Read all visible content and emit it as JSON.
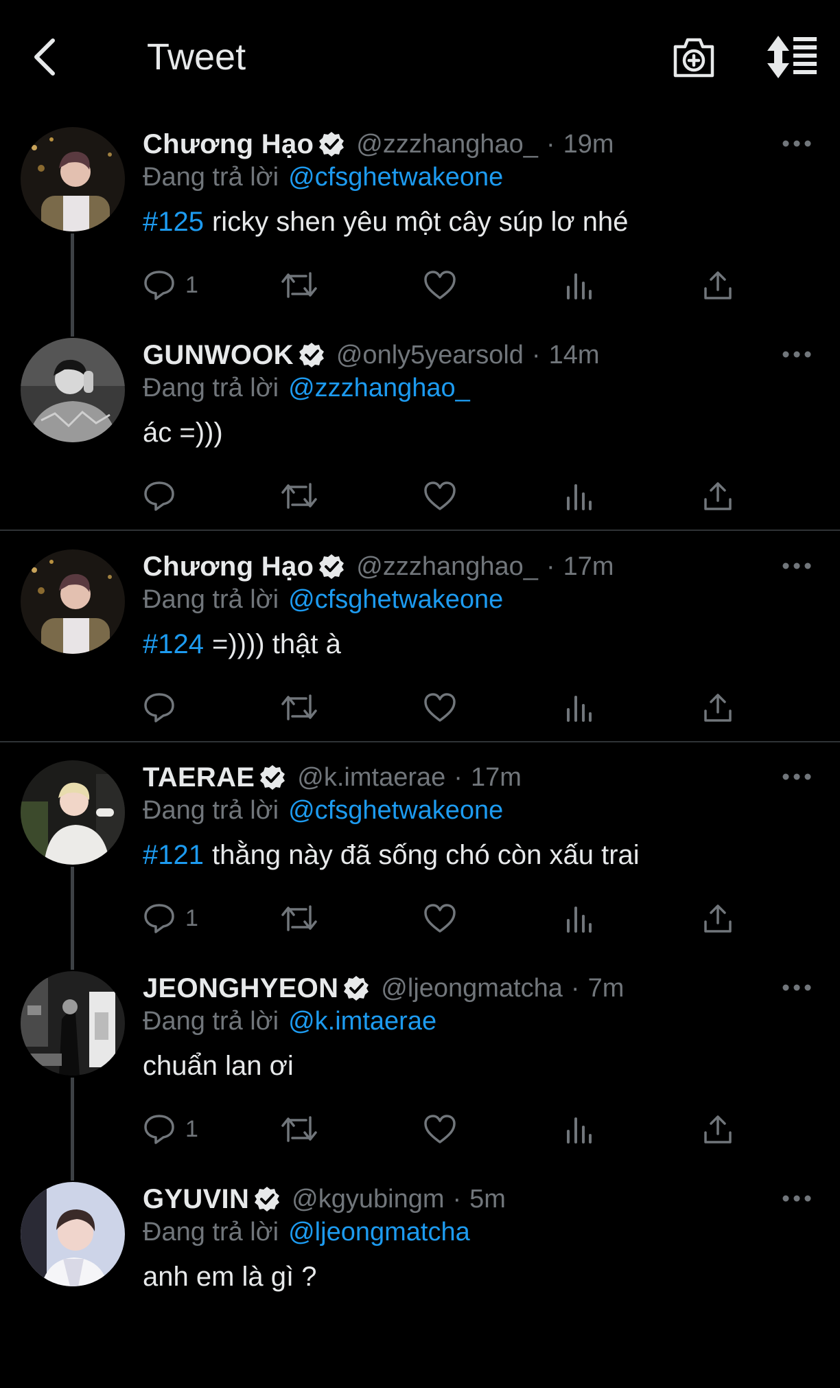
{
  "header": {
    "title": "Tweet",
    "back_icon": "chevron-left-icon",
    "camera_icon": "camera-plus-icon",
    "sort_icon": "sort-icon"
  },
  "colors": {
    "background": "#000000",
    "text": "#e7e9ea",
    "muted": "#71767b",
    "accent": "#1d9bf0",
    "divider": "#2f3336"
  },
  "reply_prefix": "Đang trả lời",
  "tweets": [
    {
      "name": "Chương Hạo",
      "verified": true,
      "handle": "@zzzhanghao_",
      "time": "19m",
      "reply_to": "@cfsghetwakeone",
      "hashtag": "#125",
      "text": "ricky shen yêu một cây súp lơ nhé",
      "reply_count": "1"
    },
    {
      "name": "GUNWOOK",
      "verified": true,
      "handle": "@only5yearsold",
      "time": "14m",
      "reply_to": "@zzzhanghao_",
      "hashtag": "",
      "text": "ác =)))",
      "reply_count": ""
    },
    {
      "name": "Chương Hạo",
      "verified": true,
      "handle": "@zzzhanghao_",
      "time": "17m",
      "reply_to": "@cfsghetwakeone",
      "hashtag": "#124",
      "text": "=)))) thật à",
      "reply_count": ""
    },
    {
      "name": "TAERAE",
      "verified": true,
      "handle": "@k.imtaerae",
      "time": "17m",
      "reply_to": "@cfsghetwakeone",
      "hashtag": "#121",
      "text": "thằng này đã sống chó còn xấu trai",
      "reply_count": "1"
    },
    {
      "name": "JEONGHYEON",
      "verified": true,
      "handle": "@ljeongmatcha",
      "time": "7m",
      "reply_to": "@k.imtaerae",
      "hashtag": "",
      "text": "chuẩn lan ơi",
      "reply_count": "1"
    },
    {
      "name": "GYUVIN",
      "verified": true,
      "handle": "@kgyubingm",
      "time": "5m",
      "reply_to": "@ljeongmatcha",
      "hashtag": "",
      "text": "anh em là gì ?",
      "reply_count": ""
    }
  ]
}
